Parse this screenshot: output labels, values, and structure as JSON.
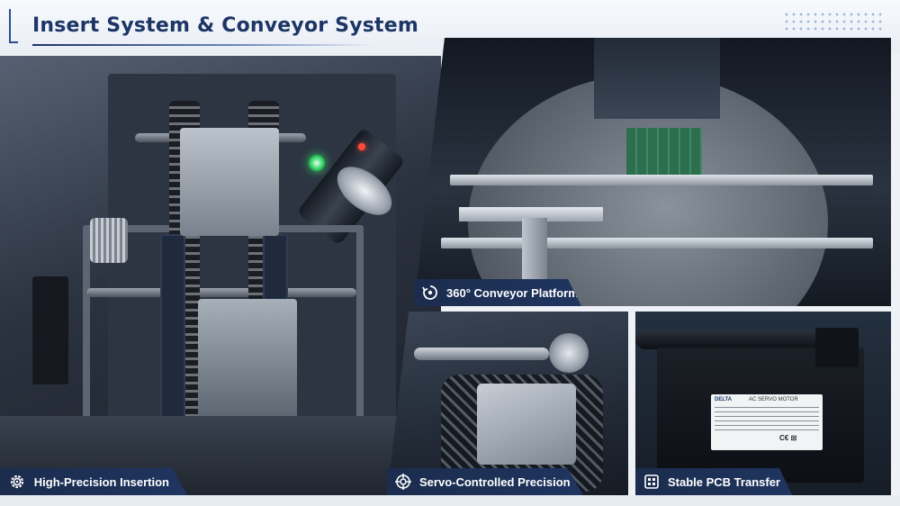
{
  "header": {
    "title": "Insert System & Conveyor System"
  },
  "panels": {
    "conveyor": {
      "label": "360° Conveyor Platform",
      "icon": "rotate-360-icon"
    },
    "insertion": {
      "label": "High-Precision Insertion",
      "icon": "gear-icon"
    },
    "servo": {
      "label": "Servo-Controlled Precision",
      "icon": "crosshair-target-icon"
    },
    "pcb": {
      "label": "Stable PCB Transfer",
      "icon": "chip-grid-icon"
    }
  },
  "motor_plate": {
    "brand": "DELTA",
    "type": "AC SERVO MOTOR"
  },
  "colors": {
    "title": "#1d3566",
    "label_bg": "#1b2c4d",
    "label_text": "#ffffff",
    "status_light": "#38d86b"
  }
}
